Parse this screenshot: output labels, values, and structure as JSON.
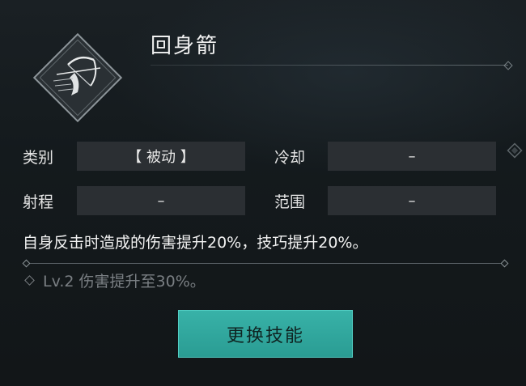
{
  "skill": {
    "name": "回身箭",
    "icon": "archer-bow-icon"
  },
  "attributes": {
    "category_label": "类别",
    "category_value": "【 被动 】",
    "cooldown_label": "冷却",
    "cooldown_value": "–",
    "range_label": "射程",
    "range_value": "–",
    "area_label": "范围",
    "area_value": "–"
  },
  "description": "自身反击时造成的伤害提升20%，技巧提升20%。",
  "level_bonus": "Lv.2 伤害提升至30%。",
  "button": {
    "switch_label": "更换技能"
  },
  "colors": {
    "accent": "#2fa59c",
    "background": "#151a1d",
    "value_box": "#2b2f33",
    "muted_text": "#7a7f83"
  }
}
